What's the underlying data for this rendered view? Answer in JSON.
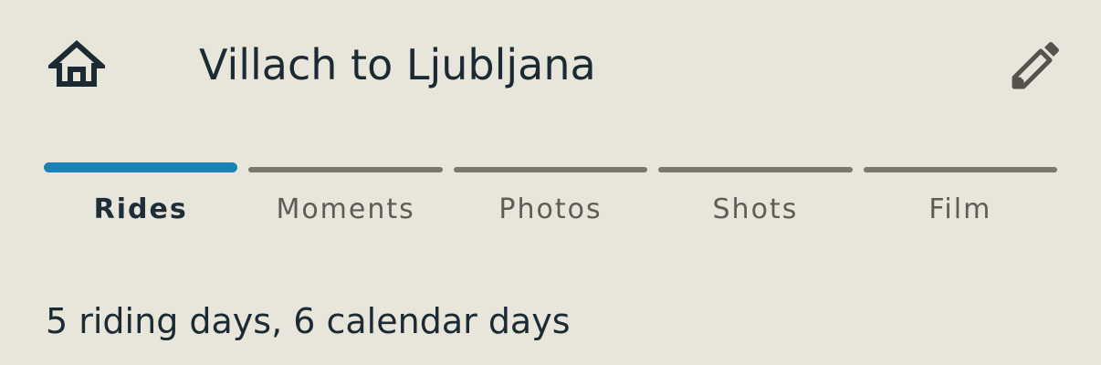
{
  "header": {
    "home_icon": "home-icon",
    "title": "Villach to Ljubljana",
    "edit_icon": "pencil-icon"
  },
  "tabs": [
    {
      "label": "Rides",
      "active": true
    },
    {
      "label": "Moments",
      "active": false
    },
    {
      "label": "Photos",
      "active": false
    },
    {
      "label": "Shots",
      "active": false
    },
    {
      "label": "Film",
      "active": false
    }
  ],
  "summary": {
    "text": "5 riding days, 6 calendar days"
  },
  "colors": {
    "background": "#E8E5DA",
    "accent": "#1983B8",
    "inactive_tab_bar": "#7B786B",
    "text_primary": "#1C2A33",
    "text_secondary": "#5E5C55"
  }
}
